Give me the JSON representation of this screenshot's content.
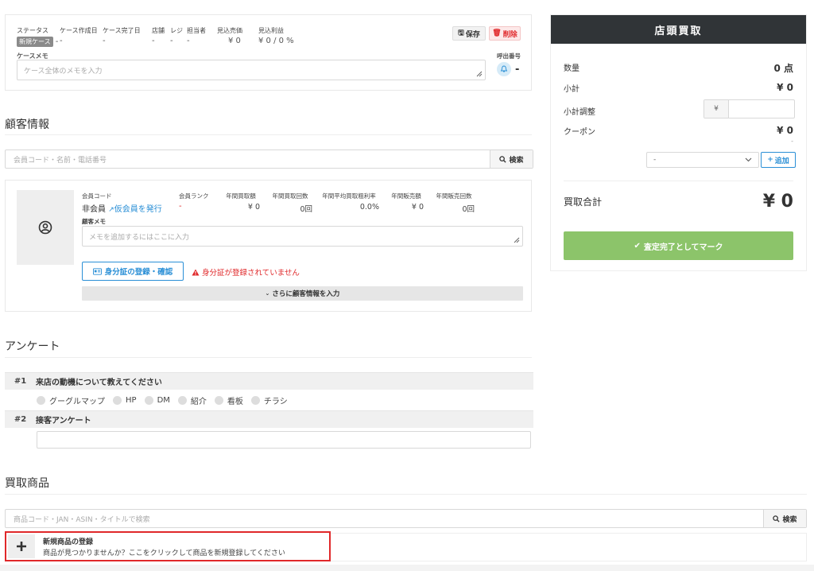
{
  "case_header": {
    "status_label": "ステータス",
    "status_value": "新規ケース",
    "status_dash": "-",
    "created_label": "ケース作成日",
    "created_value": "-",
    "completed_label": "ケース完了日",
    "completed_value": "-",
    "store_label": "店舗",
    "store_value": "-",
    "register_label": "レジ",
    "register_value": "-",
    "staff_label": "担当者",
    "staff_value": "-",
    "est_sales_label": "見込売価",
    "est_sales_value": "¥ 0",
    "est_profit_label": "見込利益",
    "est_profit_value": "¥ 0 / 0 %",
    "save_label": "保存",
    "delete_label": "削除",
    "memo_label": "ケースメモ",
    "memo_placeholder": "ケース全体のメモを入力",
    "call_label": "呼出番号",
    "call_value": "-"
  },
  "customer": {
    "section_title": "顧客情報",
    "search_placeholder": "会員コード・名前・電話番号",
    "search_button": "検索",
    "member_code_label": "会員コード",
    "member_code_value": "非会員",
    "temp_member_link": "仮会員を発行",
    "rank_label": "会員ランク",
    "rank_value": "-",
    "stats": [
      {
        "label": "年間買取額",
        "value": "¥ 0"
      },
      {
        "label": "年間買取回数",
        "value": "0回"
      },
      {
        "label": "年間平均買取粗利率",
        "value": "0.0%"
      },
      {
        "label": "年間販売額",
        "value": "¥ 0"
      },
      {
        "label": "年間販売回数",
        "value": "0回"
      }
    ],
    "memo_label": "顧客メモ",
    "memo_placeholder": "メモを追加するにはここに入力",
    "id_button": "身分証の登録・確認",
    "id_warning": "身分証が登録されていません",
    "more_button": "さらに顧客情報を入力"
  },
  "survey": {
    "section_title": "アンケート",
    "q1_num": "#1",
    "q1_text": "来店の動機について教えてください",
    "q1_options": [
      "グーグルマップ",
      "HP",
      "DM",
      "紹介",
      "看板",
      "チラシ"
    ],
    "q2_num": "#2",
    "q2_text": "接客アンケート"
  },
  "products": {
    "section_title": "買取商品",
    "search_placeholder": "商品コード・JAN・ASIN・タイトルで検索",
    "search_button": "検索",
    "new_title": "新規商品の登録",
    "new_desc": "商品が見つかりませんか？ここをクリックして商品を新規登録してください"
  },
  "panel": {
    "title": "店頭買取",
    "qty_label": "数量",
    "qty_value": "0 点",
    "subtotal_label": "小計",
    "subtotal_value": "¥ 0",
    "adjust_label": "小計調整",
    "adjust_prefix": "¥",
    "coupon_label": "クーポン",
    "coupon_value": "¥ 0",
    "coupon_dash": "-",
    "coupon_select": "-",
    "add_label": "追加",
    "total_label": "買取合計",
    "total_value": "¥ 0",
    "complete_button": "査定完了としてマーク"
  },
  "colors": {
    "accent_blue": "#2a8fd6",
    "danger_red": "#e0282a",
    "success_green": "#8cc46a",
    "panel_dark": "#303437"
  }
}
